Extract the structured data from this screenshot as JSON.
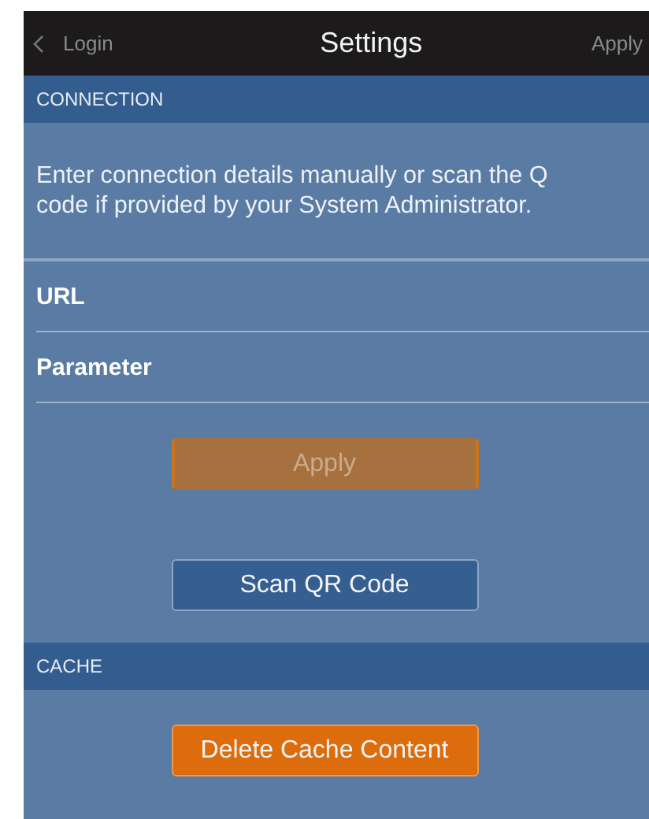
{
  "nav_bar": {
    "back_label": "Login",
    "title": "Settings",
    "action_label": "Apply"
  },
  "sections": [
    {
      "header": "CONNECTION",
      "description": "Enter connection details manually or scan the Q\ncode if provided by your System Administrator.",
      "fields": [
        {
          "label": "URL"
        },
        {
          "label": "Parameter"
        }
      ],
      "buttons": [
        {
          "label": "Apply",
          "kind": "muted",
          "disabled": true
        },
        {
          "label": "Scan QR Code",
          "kind": "outline",
          "disabled": false
        }
      ]
    },
    {
      "header": "CACHE",
      "buttons": [
        {
          "label": "Delete Cache Content",
          "kind": "primary",
          "disabled": false
        }
      ]
    }
  ]
}
